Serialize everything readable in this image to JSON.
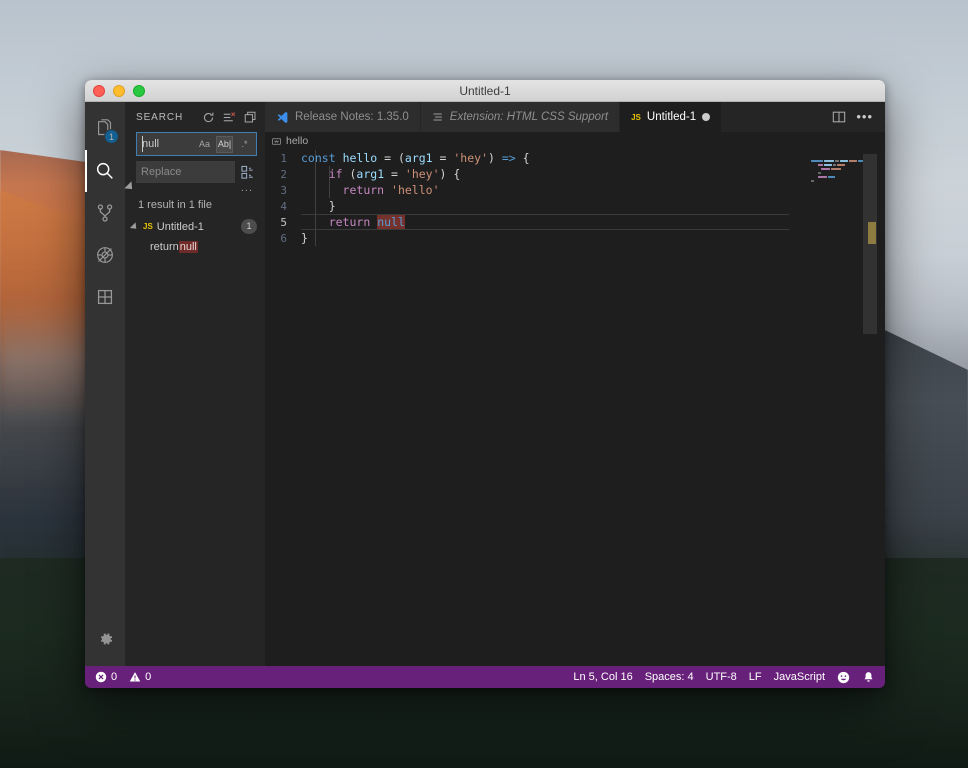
{
  "window": {
    "title": "Untitled-1",
    "traffic_lights": [
      "close-red",
      "minimize-yellow",
      "maximize-green"
    ]
  },
  "activity_bar": {
    "items": [
      {
        "name": "explorer",
        "icon": "files-icon",
        "badge": "1",
        "active": false
      },
      {
        "name": "search",
        "icon": "search-icon",
        "badge": "",
        "active": true
      },
      {
        "name": "source-control",
        "icon": "source-control-icon",
        "badge": "",
        "active": false
      },
      {
        "name": "debug",
        "icon": "debug-icon",
        "badge": "",
        "active": false
      },
      {
        "name": "extensions",
        "icon": "extensions-icon",
        "badge": "",
        "active": false
      }
    ],
    "manage": {
      "name": "manage",
      "icon": "gear-icon"
    }
  },
  "sidebar": {
    "title": "SEARCH",
    "actions": [
      {
        "name": "refresh",
        "icon": "refresh-icon"
      },
      {
        "name": "clear-search-results",
        "icon": "clear-all-icon"
      },
      {
        "name": "open-new-search-editor",
        "icon": "new-editor-icon"
      }
    ],
    "search": {
      "value": "null",
      "placeholder": "Search",
      "options": [
        {
          "name": "match-case",
          "label": "Aa",
          "active": false
        },
        {
          "name": "match-whole-word",
          "label": "Ab|",
          "active": true
        },
        {
          "name": "use-regex",
          "label": ".*",
          "active": false
        }
      ]
    },
    "replace": {
      "value": "",
      "placeholder": "Replace",
      "action": {
        "name": "replace-all",
        "icon": "replace-all-icon"
      }
    },
    "toggle_details": "...",
    "result_message": "1 result in 1 file",
    "results": [
      {
        "file": "Untitled-1",
        "file_icon": "JS",
        "count": "1",
        "expanded": true,
        "matches": [
          {
            "before": "return ",
            "match": "null",
            "after": ""
          }
        ]
      }
    ]
  },
  "editor": {
    "tabs": [
      {
        "label": "Release Notes: 1.35.0",
        "icon": "vscode-icon",
        "active": false,
        "italic": false,
        "dirty": false
      },
      {
        "label": "Extension: HTML CSS Support",
        "icon": "extension-icon",
        "active": false,
        "italic": true,
        "dirty": false
      },
      {
        "label": "Untitled-1",
        "icon": "JS",
        "active": true,
        "italic": false,
        "dirty": true
      }
    ],
    "actions": [
      {
        "name": "split-editor",
        "icon": "split-editor-icon"
      },
      {
        "name": "more-actions",
        "icon": "ellipsis-icon",
        "label": "•••"
      }
    ],
    "breadcrumb": {
      "icon": "symbol-variable-icon",
      "label": "hello"
    },
    "current_line": 5,
    "code_lines": [
      {
        "number": "1",
        "tokens": [
          {
            "t": "const",
            "c": "kw"
          },
          {
            "t": " ",
            "c": "punct"
          },
          {
            "t": "hello",
            "c": "fn"
          },
          {
            "t": " = (",
            "c": "punct"
          },
          {
            "t": "arg1",
            "c": "var"
          },
          {
            "t": " = ",
            "c": "punct"
          },
          {
            "t": "'hey'",
            "c": "str"
          },
          {
            "t": ") ",
            "c": "punct"
          },
          {
            "t": "=>",
            "c": "arrow"
          },
          {
            "t": " {",
            "c": "punct"
          }
        ]
      },
      {
        "number": "2",
        "tokens": [
          {
            "t": "    ",
            "c": "punct"
          },
          {
            "t": "if",
            "c": "ctrl"
          },
          {
            "t": " (",
            "c": "punct"
          },
          {
            "t": "arg1",
            "c": "var"
          },
          {
            "t": " = ",
            "c": "punct"
          },
          {
            "t": "'hey'",
            "c": "str"
          },
          {
            "t": ") {",
            "c": "punct"
          }
        ]
      },
      {
        "number": "3",
        "tokens": [
          {
            "t": "      ",
            "c": "punct"
          },
          {
            "t": "return",
            "c": "ctrl"
          },
          {
            "t": " ",
            "c": "punct"
          },
          {
            "t": "'hello'",
            "c": "str"
          }
        ]
      },
      {
        "number": "4",
        "tokens": [
          {
            "t": "    }",
            "c": "punct"
          }
        ]
      },
      {
        "number": "5",
        "tokens": [
          {
            "t": "    ",
            "c": "punct"
          },
          {
            "t": "return",
            "c": "ctrl"
          },
          {
            "t": " ",
            "c": "punct"
          },
          {
            "t": "null",
            "c": "const sel"
          }
        ]
      },
      {
        "number": "6",
        "tokens": [
          {
            "t": "}",
            "c": "punct"
          }
        ]
      }
    ]
  },
  "status_bar": {
    "left": [
      {
        "name": "errors-warnings",
        "icon": "error-icon",
        "label": "0"
      },
      {
        "name": "warnings-count",
        "icon": "warning-icon",
        "label": "0"
      }
    ],
    "right": [
      {
        "name": "editor-position",
        "label": "Ln 5, Col 16"
      },
      {
        "name": "editor-indentation",
        "label": "Spaces: 4"
      },
      {
        "name": "editor-encoding",
        "label": "UTF-8"
      },
      {
        "name": "editor-eol",
        "label": "LF"
      },
      {
        "name": "editor-language",
        "label": "JavaScript"
      },
      {
        "name": "feedback",
        "icon": "smiley-icon",
        "label": ""
      },
      {
        "name": "notifications",
        "icon": "bell-icon",
        "label": ""
      }
    ]
  },
  "colors": {
    "accent": "#007acc",
    "status_bar": "#68217a",
    "editor_bg": "#1e1e1e",
    "sidebar_bg": "#252526",
    "activity_bg": "#333333",
    "match_highlight": "#6f2b28",
    "selection_highlight": "#75322d"
  }
}
